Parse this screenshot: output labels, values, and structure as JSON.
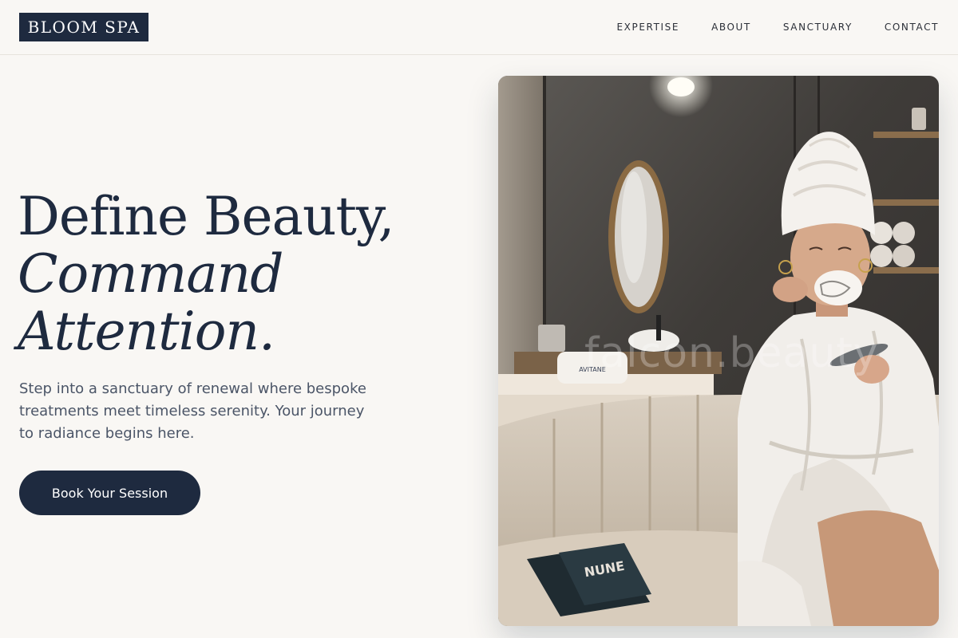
{
  "brand": {
    "name": "BLOOM SPA",
    "primary_color": "#1e2a3f",
    "background_color": "#f9f7f4"
  },
  "nav": {
    "items": [
      {
        "label": "EXPERTISE"
      },
      {
        "label": "ABOUT"
      },
      {
        "label": "SANCTUARY"
      },
      {
        "label": "CONTACT"
      }
    ]
  },
  "hero": {
    "title_line1": "Define Beauty,",
    "title_line2": "Command",
    "title_line3": "Attention.",
    "subtitle": "Step into a sanctuary of renewal where bespoke treatments meet timeless serenity. Your journey to radiance begins here.",
    "cta_label": "Book Your Session",
    "image": {
      "watermark": "falcon.beauty",
      "pillow_text": "AVITANE",
      "magazine_text": "NUNE"
    }
  }
}
